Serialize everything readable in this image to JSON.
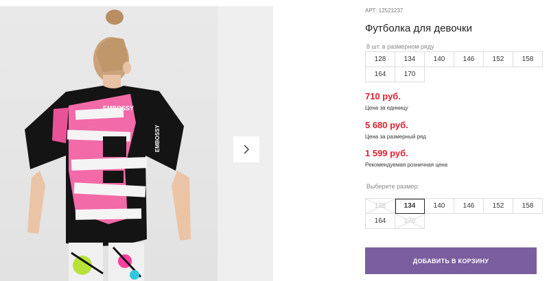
{
  "gallery": {
    "image_alt": "girl in black t-shirt, back view",
    "print_text_top": "EMBOSSY",
    "print_text_sleeve": "EMBOSSY",
    "next_icon": "chevron-right-icon"
  },
  "product": {
    "article_label": "АРТ: 12521237",
    "title": "Футболка для девочки",
    "pack_note": "8 шт. в размерном ряду",
    "pack_sizes": [
      "128",
      "134",
      "140",
      "146",
      "152",
      "158",
      "164",
      "170"
    ]
  },
  "prices": {
    "unit_price": "710 руб.",
    "unit_label": "Цена за единицу",
    "pack_price": "5 680 руб.",
    "pack_label": "Цена за размерный ряд",
    "retail_price": "1 599 руб.",
    "retail_label": "Рекомендуемая розничная цена",
    "accent_color": "#e0202f"
  },
  "size_selector": {
    "label": "Выберите размер:",
    "sizes": [
      {
        "label": "128",
        "state": "disabled"
      },
      {
        "label": "134",
        "state": "selected"
      },
      {
        "label": "140",
        "state": "available"
      },
      {
        "label": "146",
        "state": "available"
      },
      {
        "label": "152",
        "state": "available"
      },
      {
        "label": "158",
        "state": "available"
      },
      {
        "label": "164",
        "state": "available"
      },
      {
        "label": "170",
        "state": "disabled"
      }
    ]
  },
  "cart": {
    "button_label": "ДОБАВИТЬ В КОРЗИНУ",
    "button_color": "#7b5e9e"
  }
}
